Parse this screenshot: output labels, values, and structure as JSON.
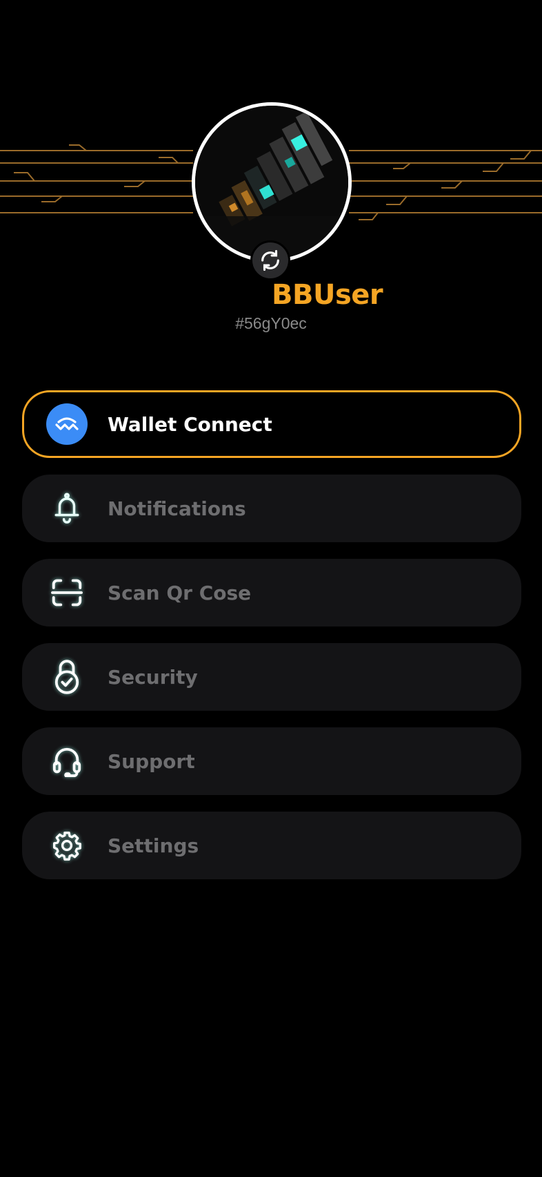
{
  "profile": {
    "username": "BBUser",
    "user_id": "#56gY0ec"
  },
  "colors": {
    "accent": "#f5a524",
    "background": "#000000",
    "card": "#141416",
    "wallet_blue": "#3b8cf6"
  },
  "menu": [
    {
      "label": "Wallet Connect",
      "icon": "walletconnect-icon",
      "active": true
    },
    {
      "label": "Notifications",
      "icon": "bell-icon",
      "active": false
    },
    {
      "label": "Scan Qr Cose",
      "icon": "scan-qr-icon",
      "active": false
    },
    {
      "label": "Security",
      "icon": "lock-check-icon",
      "active": false
    },
    {
      "label": "Support",
      "icon": "headset-icon",
      "active": false
    },
    {
      "label": "Settings",
      "icon": "gear-icon",
      "active": false
    }
  ]
}
